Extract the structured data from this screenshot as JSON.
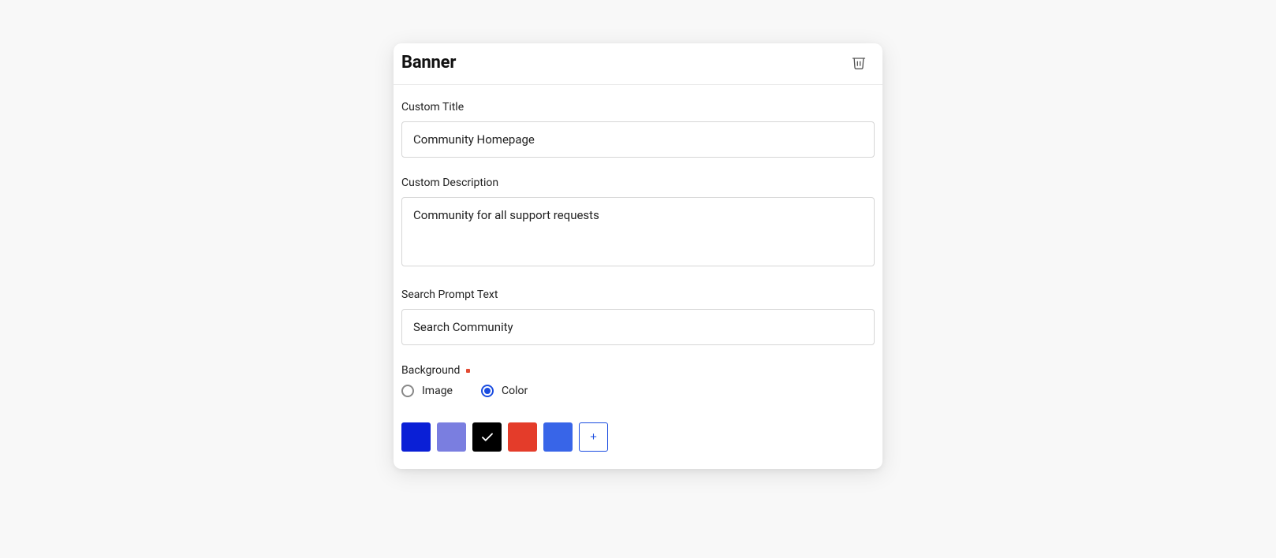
{
  "card": {
    "title": "Banner"
  },
  "fields": {
    "customTitle": {
      "label": "Custom Title",
      "value": "Community Homepage"
    },
    "customDescription": {
      "label": "Custom Description",
      "value": "Community for all support requests"
    },
    "searchPrompt": {
      "label": "Search Prompt Text",
      "value": "Search Community"
    },
    "background": {
      "label": "Background",
      "required": true,
      "options": {
        "image": {
          "label": "Image",
          "selected": false
        },
        "color": {
          "label": "Color",
          "selected": true
        }
      }
    }
  },
  "swatches": {
    "colors": [
      "#0a1fd6",
      "#7a7ee0",
      "#000000",
      "#e43c2a",
      "#3865e8"
    ],
    "selectedIndex": 2,
    "addLabel": "+"
  }
}
